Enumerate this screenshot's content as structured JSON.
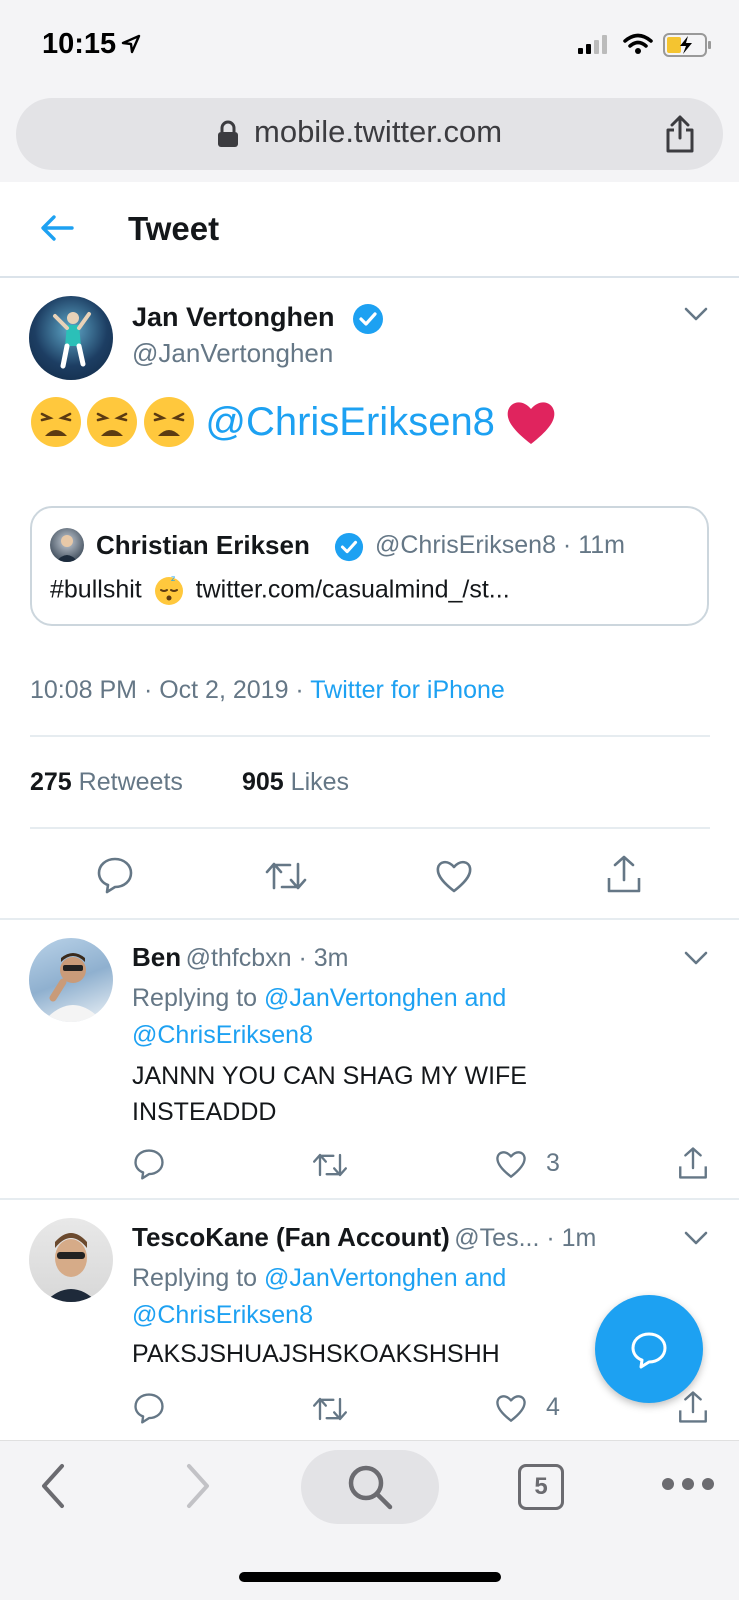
{
  "status_bar": {
    "time": "10:15"
  },
  "browser": {
    "url": "mobile.twitter.com"
  },
  "header": {
    "title": "Tweet"
  },
  "main_tweet": {
    "author_name": "Jan Vertonghen",
    "author_handle": "@JanVertonghen",
    "mention": "@ChrisEriksen8",
    "quoted": {
      "author_name": "Christian Eriksen",
      "meta": "@ChrisEriksen8 · 11m",
      "hashtag": "#bullshit",
      "link": "twitter.com/casualmind_/st..."
    },
    "timestamp": "10:08 PM · Oct 2, 2019 · ",
    "source": "Twitter for iPhone",
    "retweets_count": "275",
    "retweets_label": "Retweets",
    "likes_count": "905",
    "likes_label": "Likes"
  },
  "replies": [
    {
      "name": "Ben",
      "meta": "@thfcbxn · 3m",
      "replying_prefix": "Replying to ",
      "replying_to_1": "@JanVertonghen and",
      "replying_to_2": "@ChrisEriksen8",
      "text_line1": "JANNN YOU CAN SHAG MY WIFE",
      "text_line2": "INSTEADDD",
      "likes": "3"
    },
    {
      "name": "TescoKane (Fan Account)",
      "meta": "@Tes... · 1m",
      "replying_prefix": "Replying to ",
      "replying_to_1": "@JanVertonghen and",
      "replying_to_2": "@ChrisEriksen8",
      "text_line1": "PAKSJSHUAJSHSKOAKSHSHH",
      "likes": "4"
    }
  ],
  "safari_toolbar": {
    "tabs_count": "5"
  },
  "colors": {
    "accent": "#1da1f2",
    "text": "#14171a",
    "muted": "#657786",
    "heart": "#e0245e"
  }
}
